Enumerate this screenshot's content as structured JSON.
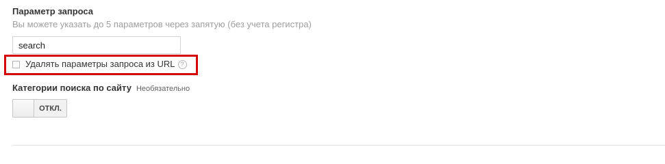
{
  "query_param": {
    "title": "Параметр запроса",
    "hint": "Вы можете указать до 5 параметров через запятую (без учета регистра)",
    "input_value": "search",
    "checkbox_label": "Удалять параметры запроса из URL",
    "checkbox_checked": false,
    "help_glyph": "?"
  },
  "site_search_categories": {
    "title": "Категории поиска по сайту",
    "optional_label": "Необязательно",
    "toggle_label": "ОТКЛ.",
    "toggle_state": "off"
  },
  "icons": {
    "help": "help-circle-icon"
  },
  "colors": {
    "highlight": "#d50000",
    "hint_text": "#9e9e9e"
  }
}
